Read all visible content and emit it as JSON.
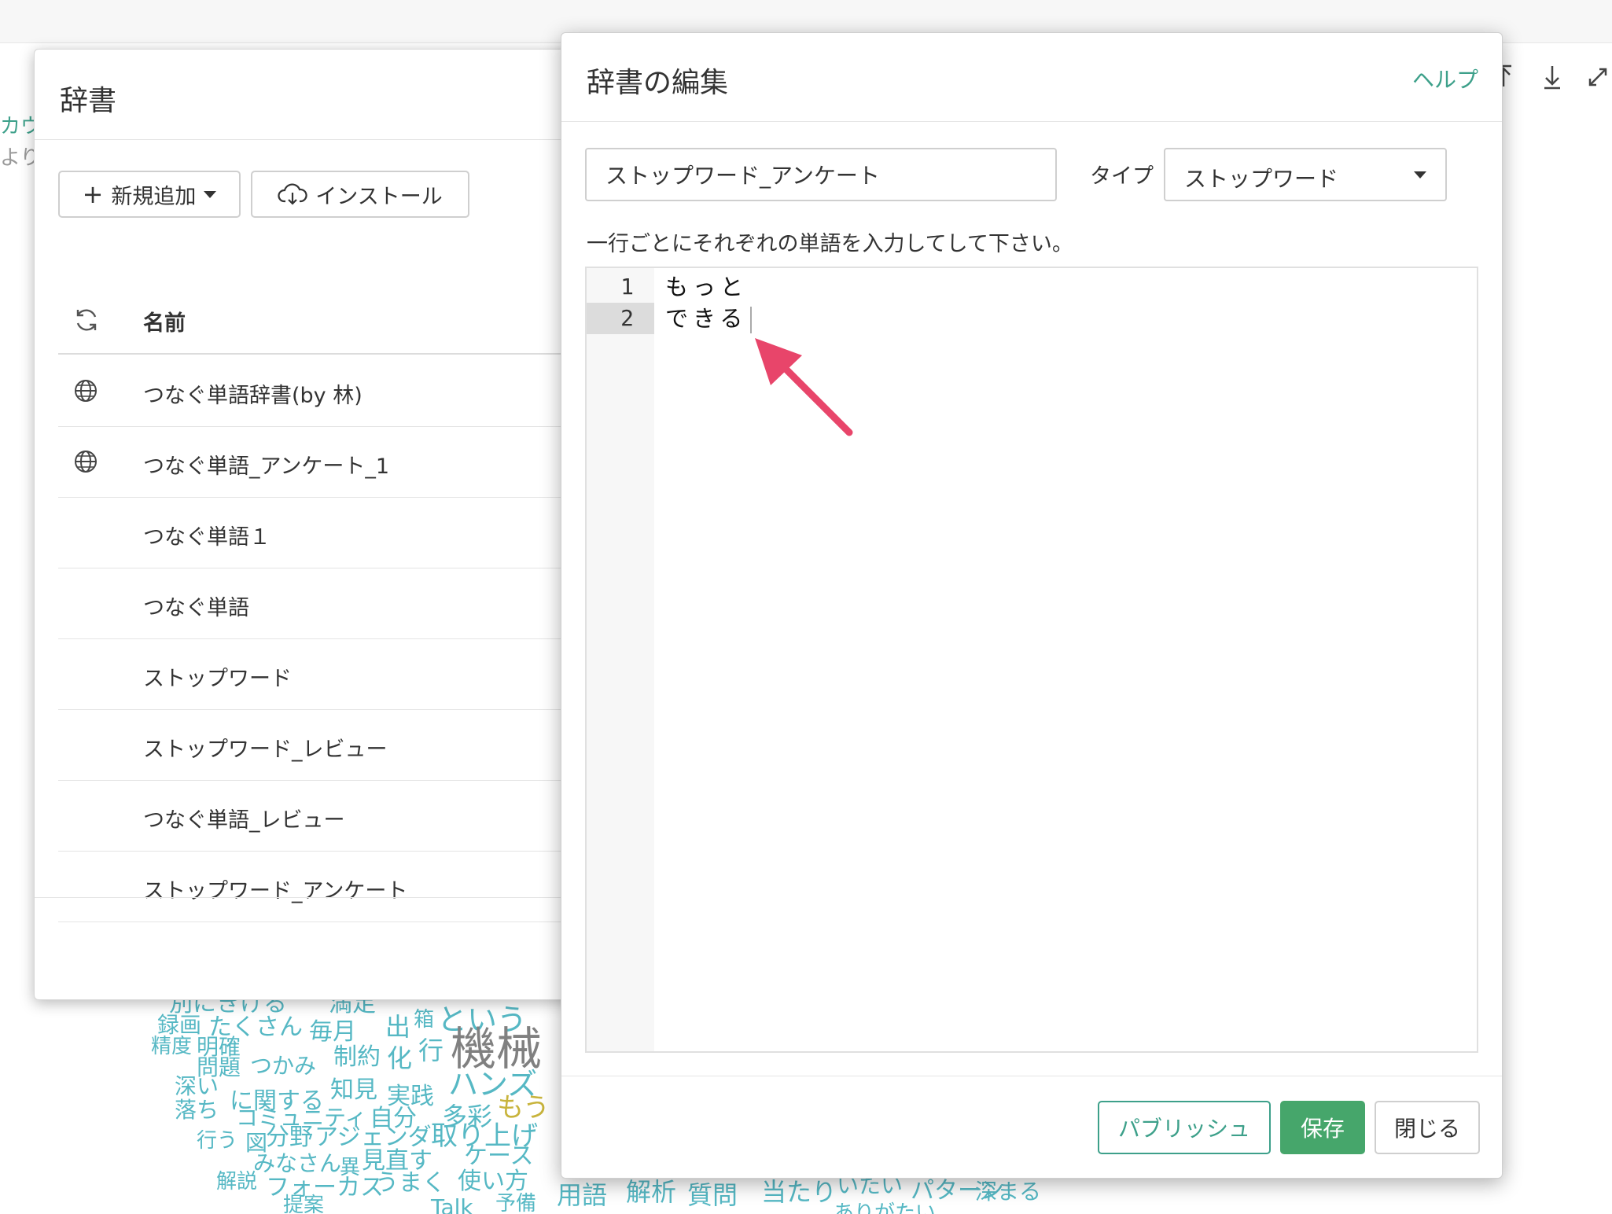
{
  "background": {
    "left_edge_text": [
      "カウ",
      "より"
    ],
    "toolbar_icons": [
      "upload-icon",
      "download-icon",
      "expand-icon"
    ],
    "word_cloud": [
      {
        "t": "録画",
        "c": "#56b8c4"
      },
      {
        "t": "別にきける",
        "c": "#56b8c4"
      },
      {
        "t": "満足",
        "c": "#56b8c4"
      },
      {
        "t": "精度",
        "c": "#56b8c4"
      },
      {
        "t": "明確",
        "c": "#56b8c4"
      },
      {
        "t": "たくさん",
        "c": "#56b8c4"
      },
      {
        "t": "毎月",
        "c": "#56b8c4"
      },
      {
        "t": "出",
        "c": "#56b8c4"
      },
      {
        "t": "箱",
        "c": "#56b8c4"
      },
      {
        "t": "という",
        "c": "#56b8c4"
      },
      {
        "t": "機械",
        "c": "#808080"
      },
      {
        "t": "問題",
        "c": "#56b8c4"
      },
      {
        "t": "つかみ",
        "c": "#56b8c4"
      },
      {
        "t": "制約",
        "c": "#56b8c4"
      },
      {
        "t": "化",
        "c": "#56b8c4"
      },
      {
        "t": "行",
        "c": "#56b8c4"
      },
      {
        "t": "深い",
        "c": "#56b8c4"
      },
      {
        "t": "に関する",
        "c": "#56b8c4"
      },
      {
        "t": "知見",
        "c": "#56b8c4"
      },
      {
        "t": "実践",
        "c": "#56b8c4"
      },
      {
        "t": "ハンズ",
        "c": "#56b8c4"
      },
      {
        "t": "落ち",
        "c": "#56b8c4"
      },
      {
        "t": "コミュニティ",
        "c": "#56b8c4"
      },
      {
        "t": "自分",
        "c": "#56b8c4"
      },
      {
        "t": "多彩",
        "c": "#56b8c4"
      },
      {
        "t": "もう",
        "c": "#c8b43c"
      },
      {
        "t": "行う",
        "c": "#56b8c4"
      },
      {
        "t": "図",
        "c": "#56b8c4"
      },
      {
        "t": "分野",
        "c": "#56b8c4"
      },
      {
        "t": "アジェンダ",
        "c": "#56b8c4"
      },
      {
        "t": "取り上げ",
        "c": "#56b8c4"
      },
      {
        "t": "みなさん",
        "c": "#56b8c4"
      },
      {
        "t": "異",
        "c": "#56b8c4"
      },
      {
        "t": "見直す",
        "c": "#56b8c4"
      },
      {
        "t": "解説",
        "c": "#56b8c4"
      },
      {
        "t": "フォーカス",
        "c": "#56b8c4"
      },
      {
        "t": "うまく",
        "c": "#56b8c4"
      },
      {
        "t": "使い方",
        "c": "#56b8c4"
      },
      {
        "t": "ケース",
        "c": "#56b8c4"
      },
      {
        "t": "提案",
        "c": "#56b8c4"
      },
      {
        "t": "Talk",
        "c": "#56b8c4"
      },
      {
        "t": "予備",
        "c": "#56b8c4"
      },
      {
        "t": "用語",
        "c": "#56b8c4"
      },
      {
        "t": "解析",
        "c": "#56b8c4"
      },
      {
        "t": "質問",
        "c": "#56b8c4"
      },
      {
        "t": "当たり",
        "c": "#56b8c4"
      },
      {
        "t": "いたい",
        "c": "#56b8c4"
      },
      {
        "t": "パターン",
        "c": "#56b8c4"
      },
      {
        "t": "深まる",
        "c": "#56b8c4"
      },
      {
        "t": "ありがたい",
        "c": "#56b8c4"
      }
    ]
  },
  "dictionary_modal": {
    "title": "辞書",
    "add_button": "新規追加",
    "install_button": "インストール",
    "column_name": "名前",
    "rows": [
      {
        "label": "つなぐ単語辞書(by 林)",
        "icon": "globe-icon"
      },
      {
        "label": "つなぐ単語_アンケート_1",
        "icon": "globe-icon"
      },
      {
        "label": "つなぐ単語１",
        "icon": ""
      },
      {
        "label": "つなぐ単語",
        "icon": ""
      },
      {
        "label": "ストップワード",
        "icon": ""
      },
      {
        "label": "ストップワード_レビュー",
        "icon": ""
      },
      {
        "label": "つなぐ単語_レビュー",
        "icon": ""
      },
      {
        "label": "ストップワード_アンケート",
        "icon": ""
      }
    ]
  },
  "edit_modal": {
    "title": "辞書の編集",
    "help_link": "ヘルプ",
    "name_value": "ストップワード_アンケート",
    "type_label": "タイプ",
    "type_selected": "ストップワード",
    "instructions": "一行ごとにそれぞれの単語を入力してして下さい。",
    "editor_lines": [
      {
        "num": "1",
        "text": "もっと"
      },
      {
        "num": "2",
        "text": "できる"
      }
    ],
    "publish_button": "パブリッシュ",
    "save_button": "保存",
    "close_button": "閉じる"
  },
  "colors": {
    "accent_green": "#3da08a",
    "save_green": "#46a66b",
    "annotation_arrow": "#e8456a"
  }
}
